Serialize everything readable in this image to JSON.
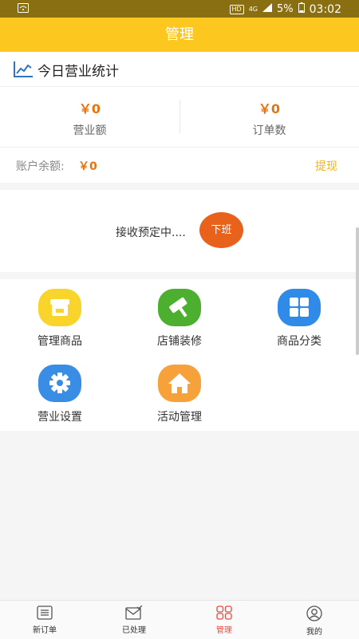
{
  "status_bar": {
    "network": "4G",
    "battery": "5%",
    "time": "03:02",
    "hd": "HD"
  },
  "header": {
    "title": "管理"
  },
  "today_stats": {
    "title": "今日营业统计",
    "revenue": {
      "value": "￥0",
      "label": "营业额"
    },
    "orders": {
      "value": "￥0",
      "label": "订单数"
    }
  },
  "balance": {
    "label": "账户余额:",
    "value": "￥0",
    "withdraw_label": "提现"
  },
  "receiving": {
    "status_text": "接收预定中....",
    "off_duty_label": "下班"
  },
  "grid": {
    "items": [
      {
        "label": "管理商品",
        "icon": "store-icon",
        "color": "#f9d52c"
      },
      {
        "label": "店铺装修",
        "icon": "paint-roller-icon",
        "color": "#4caf2f"
      },
      {
        "label": "商品分类",
        "icon": "category-grid-icon",
        "color": "#2f8ae8"
      },
      {
        "label": "营业设置",
        "icon": "gear-icon",
        "color": "#3a8de4"
      },
      {
        "label": "活动管理",
        "icon": "home-icon",
        "color": "#f6a13a"
      }
    ]
  },
  "bottom_nav": {
    "items": [
      {
        "label": "新订单",
        "icon": "new-orders-icon"
      },
      {
        "label": "已处理",
        "icon": "processed-icon"
      },
      {
        "label": "管理",
        "icon": "manage-icon",
        "active": true
      },
      {
        "label": "我的",
        "icon": "profile-icon"
      }
    ]
  },
  "colors": {
    "brand": "#fcc71f",
    "accent": "#e8730d",
    "active_nav": "#e84c3d",
    "off_duty_button": "#e9621b"
  }
}
